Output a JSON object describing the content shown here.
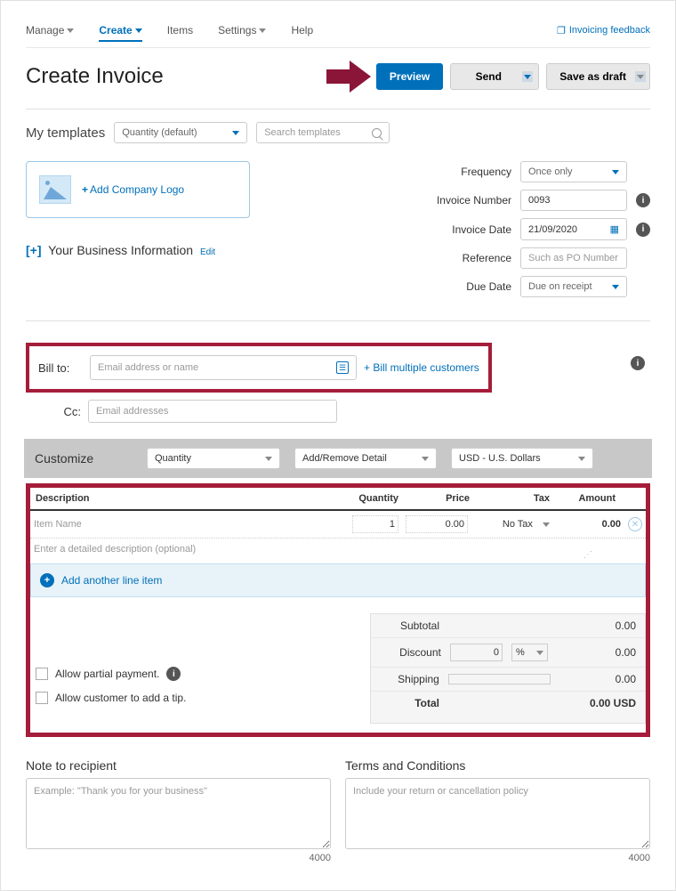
{
  "nav": {
    "manage": "Manage",
    "create": "Create",
    "items": "Items",
    "settings": "Settings",
    "help": "Help",
    "feedback": "Invoicing feedback"
  },
  "header": {
    "title": "Create Invoice",
    "preview": "Preview",
    "send": "Send",
    "save_draft": "Save as draft"
  },
  "templates": {
    "label": "My templates",
    "selected": "Quantity (default)",
    "search_placeholder": "Search templates"
  },
  "logo": {
    "add_text": "Add Company Logo"
  },
  "meta": {
    "frequency_label": "Frequency",
    "frequency_value": "Once only",
    "invoice_number_label": "Invoice Number",
    "invoice_number_value": "0093",
    "invoice_date_label": "Invoice Date",
    "invoice_date_value": "21/09/2020",
    "reference_label": "Reference",
    "reference_placeholder": "Such as PO Number",
    "due_date_label": "Due Date",
    "due_date_value": "Due on receipt"
  },
  "biz_info": {
    "label": "Your Business Information",
    "edit": "Edit",
    "expand": "[+]"
  },
  "billto": {
    "label": "Bill to:",
    "placeholder": "Email address or name",
    "multi": "+ Bill multiple customers",
    "cc_label": "Cc:",
    "cc_placeholder": "Email addresses"
  },
  "customize": {
    "label": "Customize",
    "sel1": "Quantity",
    "sel2": "Add/Remove Detail",
    "sel3": "USD - U.S. Dollars"
  },
  "items": {
    "hdr_desc": "Description",
    "hdr_qty": "Quantity",
    "hdr_price": "Price",
    "hdr_tax": "Tax",
    "hdr_amount": "Amount",
    "row": {
      "name_placeholder": "Item Name",
      "qty": "1",
      "price": "0.00",
      "tax": "No Tax",
      "amount": "0.00",
      "detail_placeholder": "Enter a detailed description (optional)"
    },
    "add_line": "Add another line item"
  },
  "totals": {
    "subtotal_label": "Subtotal",
    "subtotal_value": "0.00",
    "discount_label": "Discount",
    "discount_value": "0",
    "discount_unit": "%",
    "discount_amount": "0.00",
    "shipping_label": "Shipping",
    "shipping_amount": "0.00",
    "total_label": "Total",
    "total_value": "0.00 USD",
    "partial_label": "Allow partial payment.",
    "tip_label": "Allow customer to add a tip."
  },
  "notes": {
    "note_title": "Note to recipient",
    "note_placeholder": "Example: \"Thank you for your business\"",
    "terms_title": "Terms and Conditions",
    "terms_placeholder": "Include your return or cancellation policy",
    "char_limit": "4000"
  }
}
